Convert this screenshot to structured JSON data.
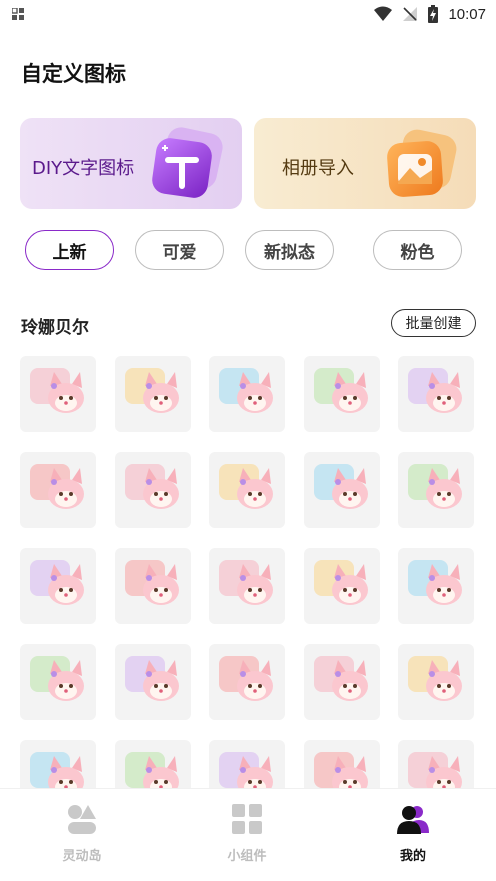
{
  "status_bar": {
    "time": "10:07",
    "icons": [
      "grid-notification-icon",
      "wifi-icon",
      "no-signal-icon",
      "battery-charging-icon"
    ]
  },
  "page": {
    "title": "自定义图标"
  },
  "cards": [
    {
      "label": "DIY文字图标",
      "icon": "text-t-icon",
      "accent": "#8a2ac9"
    },
    {
      "label": "相册导入",
      "icon": "photo-album-icon",
      "accent": "#f08a2a"
    }
  ],
  "tabs": [
    {
      "label": "上新",
      "active": true
    },
    {
      "label": "可爱",
      "active": false
    },
    {
      "label": "新拟态",
      "active": false
    },
    {
      "label": "粉色",
      "active": false
    }
  ],
  "section": {
    "title": "玲娜贝尔",
    "batch_button": "批量创建"
  },
  "icons_grid": [
    "linabell-book-icon",
    "linabell-dingtalk-icon",
    "linabell-clock-icon",
    "linabell-netease-music-icon",
    "linabell-alipay-icon",
    "linabell-qq-icon",
    "linabell-iqiyi-icon",
    "linabell-bilibili-icon",
    "linabell-douyin-icon",
    "linabell-wechat-icon",
    "linabell-phone-icon",
    "linabell-05-radio-icon",
    "linabell-pinduoduo-icon",
    "linabell-umbrella-icon",
    "linabell-weather-icon",
    "linabell-mangotv-icon",
    "linabell-tencent-video-icon",
    "linabell-kuaishou-icon",
    "linabell-photo-card-icon",
    "linabell-notes-icon",
    "linabell-wing-icon",
    "linabell-calendar-icon",
    "linabell-camera-icon",
    "linabell-calculator-icon",
    "linabell-hat-icon"
  ],
  "bottom_nav": [
    {
      "label": "灵动岛",
      "icon": "dynamic-island-icon",
      "active": false
    },
    {
      "label": "小组件",
      "icon": "widgets-icon",
      "active": false
    },
    {
      "label": "我的",
      "icon": "profile-icon",
      "active": true
    }
  ],
  "colors": {
    "accent_purple": "#8a2ac9",
    "pink": "#f6b3bf",
    "inactive_gray": "#bdbdbd"
  }
}
